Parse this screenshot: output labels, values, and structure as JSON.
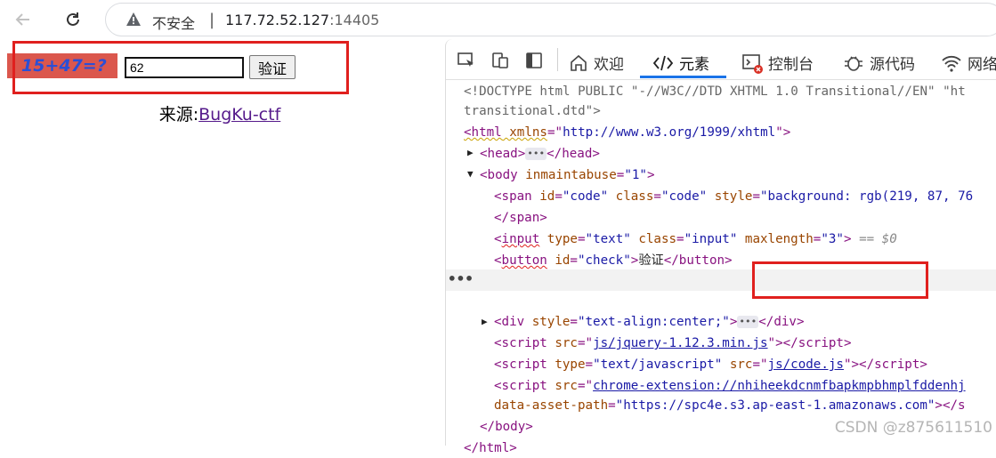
{
  "browser": {
    "security_label": "不安全",
    "separator": "|",
    "url_host": "117.72.52.127",
    "url_port": ":14405"
  },
  "page": {
    "captcha_text": "15+47=?",
    "answer_value": "62",
    "submit_label": "验证",
    "source_prefix": "来源:",
    "source_link": "BugKu-ctf"
  },
  "devtools": {
    "tabs": [
      {
        "label": "欢迎",
        "icon": "home-icon"
      },
      {
        "label": "元素",
        "icon": "code-brackets-icon"
      },
      {
        "label": "控制台",
        "icon": "console-icon"
      },
      {
        "label": "源代码",
        "icon": "bug-icon"
      },
      {
        "label": "网络",
        "icon": "wifi-icon"
      }
    ],
    "active_tab": "元素",
    "dom": {
      "doctype_1": "<!DOCTYPE html PUBLIC \"-//W3C//DTD XHTML 1.0 Transitional//EN\" \"ht",
      "doctype_2": "transitional.dtd\">",
      "html_open_tag": "<html",
      "html_attr": " xmlns",
      "html_eq": "=\"",
      "html_val": "http://www.w3.org/1999/xhtml",
      "html_close": "\">",
      "head": "<head>",
      "head_end": "</head>",
      "body_tag": "<body",
      "body_attr": " inmaintabuse",
      "body_val": "\"1\"",
      "span_tag": "<span",
      "span_id_attr": " id",
      "span_id_val": "\"code\"",
      "span_class_attr": " class",
      "span_class_val": "\"code\"",
      "span_style_attr": " style",
      "span_style_val": "\"background: rgb(219, 87, 76",
      "span_end": "</span>",
      "input_tag": "input",
      "input_type_attr": " type",
      "input_type_val": "\"text\"",
      "input_class_attr": " class",
      "input_class_val": "\"input\"",
      "input_max_attr": "maxlength",
      "input_max_val": "\"3\"",
      "eq_dollar": "== $0",
      "button_tag": "button",
      "button_id_attr": " id",
      "button_id_val": "\"check\"",
      "button_text": "验证",
      "button_end": "</button>",
      "div_tag": "<div",
      "div_style_attr": " style",
      "div_style_val": "\"text-align:center;\"",
      "div_end": "</div>",
      "script1_src": "js/jquery-1.12.3.min.js",
      "script2_type": "\"text/javascript\"",
      "script2_src": "js/code.js",
      "script3_src": "chrome-extension://nhiheekdcnmfbapkmpbhmplfddenhj",
      "script3_asset_attr": "data-asset-path",
      "script3_asset_val": "\"https://spc4e.s3.ap-east-1.amazonaws.com\"",
      "script_close_tail": "></s",
      "body_end": "</body>",
      "html_end": "</html>"
    }
  },
  "watermark": "CSDN @z875611510",
  "colors": {
    "captcha_bg": "#db574d",
    "captcha_text": "#2b4fd6",
    "highlight_box": "#e0201e",
    "devtools_active": "#1a73e8"
  }
}
